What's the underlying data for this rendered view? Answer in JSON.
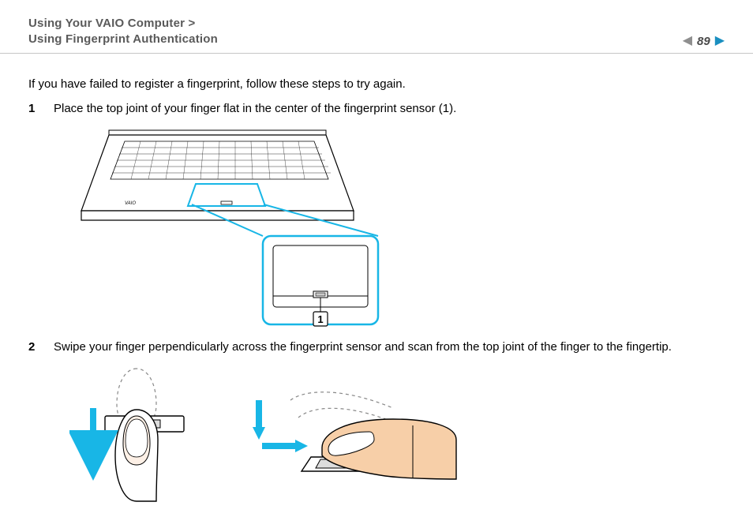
{
  "header": {
    "breadcrumb_line1": "Using Your VAIO Computer >",
    "breadcrumb_line2": "Using Fingerprint Authentication",
    "page_number": "89"
  },
  "content": {
    "intro": "If you have failed to register a fingerprint, follow these steps to try again.",
    "steps": [
      {
        "num": "1",
        "text": "Place the top joint of your finger flat in the center of the fingerprint sensor (1)."
      },
      {
        "num": "2",
        "text": "Swipe your finger perpendicularly across the fingerprint sensor and scan from the top joint of the finger to the fingertip."
      }
    ],
    "figure1_callout_label": "1"
  }
}
